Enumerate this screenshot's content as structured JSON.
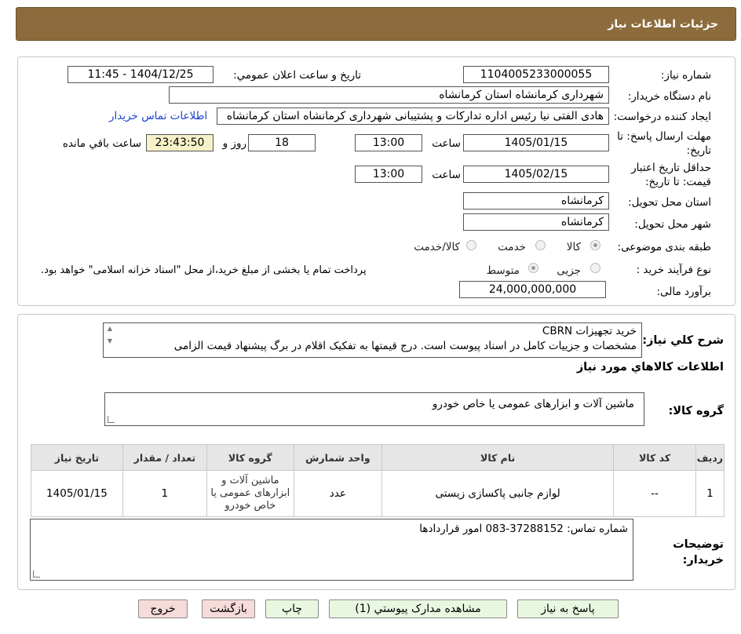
{
  "header": {
    "title": "جزئیات اطلاعات نیاز"
  },
  "info": {
    "need_number_label": "شماره نیاز:",
    "need_number": "1104005233000055",
    "announce_label": "تاریخ و ساعت اعلان عمومي:",
    "announce_value": "1404/12/25 - 11:45",
    "buyer_org_label": "نام دستگاه خریدار:",
    "buyer_org": "شهرداری کرمانشاه استان کرمانشاه",
    "creator_label": "ایجاد کننده درخواست:",
    "creator": "هادی الفتی نیا رئیس اداره تدارکات و پشتیبانی شهرداری کرمانشاه استان کرمانشاه",
    "contact_link": "اطلاعات تماس خریدار",
    "deadline_label": "مهلت ارسال پاسخ: تا تاریخ:",
    "deadline_date": "1405/01/15",
    "time_label": "ساعت",
    "deadline_time": "13:00",
    "days_value": "18",
    "days_and_label": "روز و",
    "remaining_time": "23:43:50",
    "remaining_label": "ساعت باقي مانده",
    "validity_label": "حداقل تاریخ اعتبار قیمت: تا تاریخ:",
    "validity_date": "1405/02/15",
    "validity_time": "13:00",
    "province_label": "استان محل تحویل:",
    "province": "کرمانشاه",
    "city_label": "شهر محل تحویل:",
    "city": "کرمانشاه",
    "category_label": "طبقه بندی موضوعی:",
    "category_options": [
      "کالا",
      "خدمت",
      "کالا/خدمت"
    ],
    "process_label": "نوع فرآیند خرید :",
    "process_options": [
      "جزیی",
      "متوسط"
    ],
    "process_note": "پرداخت تمام یا بخشی از مبلغ خرید،از محل \"اسناد خزانه اسلامی\" خواهد بود.",
    "budget_label": "برآورد مالی:",
    "budget": "24,000,000,000"
  },
  "description": {
    "label": "شرح کلي نیاز:",
    "line1": "خرید تجهیزات CBRN",
    "line2": "مشخصات و جزییات کامل در اسناد پیوست است. درج قیمتها به تفکیک اقلام در برگ پیشنهاد قیمت الزامی"
  },
  "goods": {
    "section_title": "اطلاعات کالاهاي مورد نیاز",
    "group_label": "گروه کالا:",
    "group_value": "ماشین آلات و ابزارهای عمومی یا خاص خودرو",
    "columns": [
      "ردیف",
      "کد کالا",
      "نام کالا",
      "واحد شمارش",
      "گروه کالا",
      "تعداد / مقدار",
      "تاریخ نیاز"
    ],
    "rows": [
      [
        "1",
        "--",
        "لوازم جانبی پاکسازی زیستی",
        "عدد",
        "ماشین آلات و ابزارهای عمومی یا خاص خودرو",
        "1",
        "1405/01/15"
      ]
    ]
  },
  "buyer_notes": {
    "label": "توضیحات خریدار:",
    "value": "شماره تماس: 37288152-083 امور قراردادها"
  },
  "buttons": {
    "reply": "پاسخ به نیاز",
    "view_docs": "مشاهده مدارک پیوستي (1)",
    "print": "چاپ",
    "back": "بازگشت",
    "exit": "خروج"
  },
  "colors": {
    "header_bg": "#8c6b3c",
    "link": "#1a3fd6",
    "button_green": "#e9f7e1",
    "button_red": "#f7dada"
  }
}
